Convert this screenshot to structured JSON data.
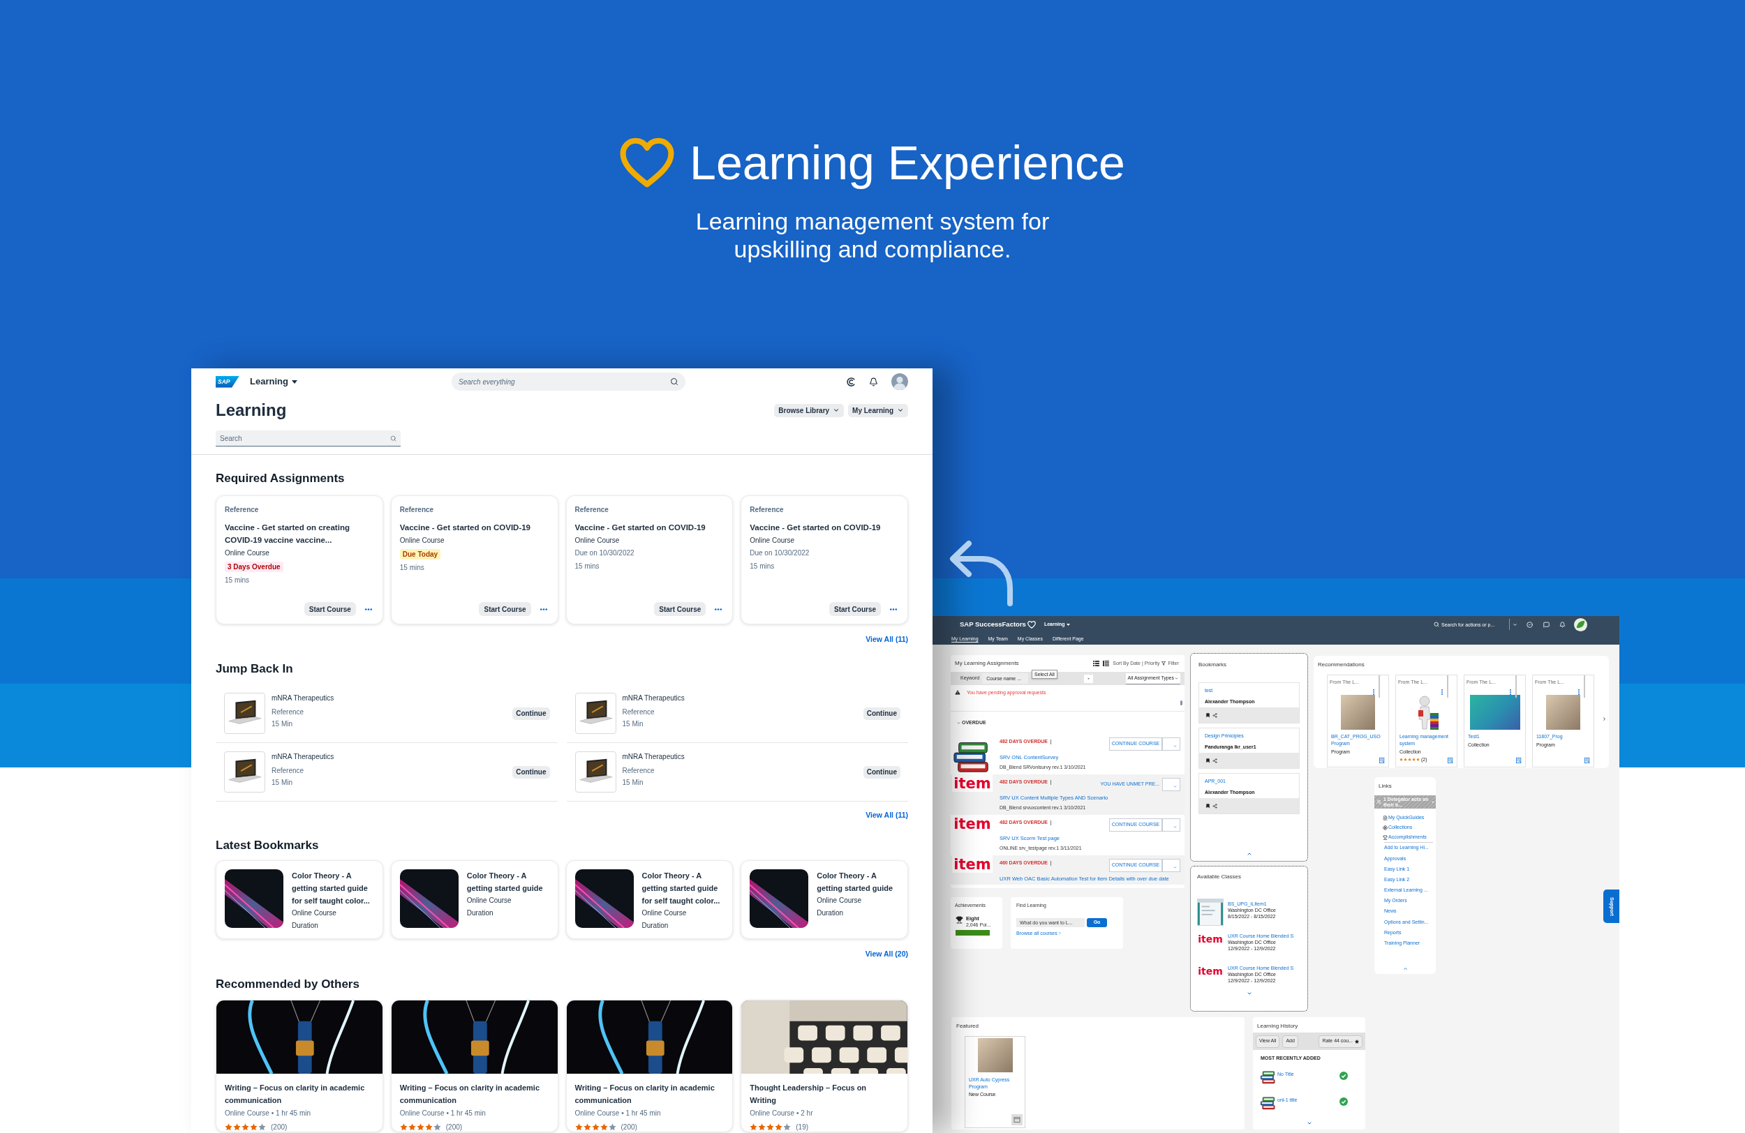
{
  "hero": {
    "title": "Learning Experience",
    "subtitle": "Learning management system for upskilling and compliance."
  },
  "learning_app": {
    "top_bar": {
      "logo": "SAP",
      "product": "Learning",
      "search_placeholder": "Search everything"
    },
    "page_title": "Learning",
    "header_buttons": [
      "Browse Library",
      "My Learning"
    ],
    "search": {
      "placeholder": "Search"
    },
    "required_assignments": {
      "title": "Required Assignments",
      "cards": [
        {
          "category": "Reference",
          "title": "Vaccine - Get started on creating COVID-19 vaccine vaccine...",
          "type": "Online Course",
          "status": {
            "kind": "overdue",
            "text": "3 Days Overdue"
          },
          "duration": "15 mins",
          "action": "Start Course"
        },
        {
          "category": "Reference",
          "title": "Vaccine - Get started on COVID-19",
          "type": "Online Course",
          "status": {
            "kind": "due_today",
            "text": "Due Today"
          },
          "duration": "15 mins",
          "action": "Start Course"
        },
        {
          "category": "Reference",
          "title": "Vaccine - Get started on COVID-19",
          "type": "Online Course",
          "status": {
            "kind": "due_date",
            "text": "Due on 10/30/2022"
          },
          "duration": "15 mins",
          "action": "Start Course"
        },
        {
          "category": "Reference",
          "title": "Vaccine - Get started on COVID-19",
          "type": "Online Course",
          "status": {
            "kind": "due_date",
            "text": "Due on 10/30/2022"
          },
          "duration": "15 mins",
          "action": "Start Course"
        }
      ],
      "view_all": "View All (11)"
    },
    "jump_back_in": {
      "title": "Jump Back In",
      "items": [
        {
          "title": "mNRA Therapeutics",
          "category": "Reference",
          "duration": "15 Min",
          "action": "Continue"
        },
        {
          "title": "mNRA Therapeutics",
          "category": "Reference",
          "duration": "15 Min",
          "action": "Continue"
        },
        {
          "title": "mNRA Therapeutics",
          "category": "Reference",
          "duration": "15 Min",
          "action": "Continue"
        },
        {
          "title": "mNRA Therapeutics",
          "category": "Reference",
          "duration": "15 Min",
          "action": "Continue"
        }
      ],
      "view_all": "View All (11)"
    },
    "latest_bookmarks": {
      "title": "Latest Bookmarks",
      "cards": [
        {
          "title": "Color Theory - A getting started guide for self taught color...",
          "type": "Online Course",
          "duration": "Duration"
        },
        {
          "title": "Color Theory - A getting started guide",
          "type": "Online Course",
          "duration": "Duration"
        },
        {
          "title": "Color Theory - A getting started guide for self taught color...",
          "type": "Online Course",
          "duration": "Duration"
        },
        {
          "title": "Color Theory - A getting started guide",
          "type": "Online Course",
          "duration": "Duration"
        }
      ],
      "view_all": "View All (20)"
    },
    "recommended": {
      "title": "Recommended by Others",
      "cards": [
        {
          "kind": "bulb",
          "title": "Writing – Focus on clarity in academic communication",
          "meta": "Online Course • 1 hr 45 min",
          "stars": 4,
          "count": "(200)"
        },
        {
          "kind": "bulb",
          "title": "Writing – Focus on clarity in academic communication",
          "meta": "Online Course • 1 hr 45 min",
          "stars": 4,
          "count": "(200)"
        },
        {
          "kind": "bulb",
          "title": "Writing – Focus on clarity in academic communication",
          "meta": "Online Course • 1 hr 45 min",
          "stars": 4,
          "count": "(200)"
        },
        {
          "kind": "typewriter",
          "title": "Thought Leadership – Focus on Writing",
          "meta": "Online Course • 2 hr",
          "stars": 4,
          "count": "(19)"
        }
      ]
    }
  },
  "successfactors_app": {
    "header": {
      "brand": "SAP SuccessFactors",
      "module": "Learning",
      "search_placeholder": "Search for actions or p...",
      "tabs": [
        {
          "label": "My Learning",
          "selected": true
        },
        {
          "label": "My Team",
          "selected": false
        },
        {
          "label": "My Classes",
          "selected": false
        },
        {
          "label": "Different Page",
          "selected": false
        }
      ]
    },
    "assignments": {
      "title": "My Learning Assignments",
      "sort": "Sort By Date | Priority",
      "filter": "Filter",
      "keyword_label": "Keyword",
      "keyword_placeholder": "Course name ...",
      "tooltip": "Select All",
      "type_filter": "All Assignment Types",
      "alert": "You have pending approval requests",
      "group": {
        "label": "OVERDUE",
        "expanded": true
      },
      "items": [
        {
          "thumb": {
            "kind": "books"
          },
          "overdue": "482 DAYS OVERDUE",
          "action": {
            "kind": "button",
            "label": "CONTINUE COURSE"
          },
          "title": "SRV ONL ContentSurvey",
          "details": "DB_Blend SRVonlsurvy rev.1 3/10/2021"
        },
        {
          "thumb": {
            "kind": "logo",
            "text": "item"
          },
          "overdue": "482 DAYS OVERDUE",
          "action": {
            "kind": "notice",
            "label": "YOU HAVE UNMET PRE..."
          },
          "title": "SRV UX Content Multiple Types AND Scenario",
          "details": "DB_Blend srvuxcontent rev.1 3/10/2021"
        },
        {
          "thumb": {
            "kind": "logo",
            "text": "item"
          },
          "overdue": "482 DAYS OVERDUE",
          "action": {
            "kind": "button",
            "label": "CONTINUE COURSE"
          },
          "title": "SRV UX Scorm Test page",
          "details": "ONLINE srv_testpage rev.1 3/11/2021"
        },
        {
          "thumb": {
            "kind": "logo",
            "text": "item"
          },
          "overdue": "460 DAYS OVERDUE",
          "action": {
            "kind": "button",
            "label": "CONTINUE COURSE"
          },
          "title": "UXR Web OAC Basic Automation Test for item Details with over due date"
        }
      ]
    },
    "achievements": {
      "title": "Achievements",
      "level_name": "Eight",
      "points": "2,046 Poi...",
      "level": 1
    },
    "find_learning": {
      "title": "Find Learning",
      "placeholder": "What do you want to L...",
      "button": "Go",
      "link": "Browse all courses"
    },
    "bookmarks": {
      "title": "Bookmarks",
      "items": [
        {
          "title": "test",
          "author": "Alexander Thompson"
        },
        {
          "title": "Design Priniciples",
          "author": "Panduranga lkr_user1"
        },
        {
          "title": "APR_001",
          "author": "Alexander Thompson"
        }
      ]
    },
    "available_classes": {
      "title": "Available Classes",
      "items": [
        {
          "thumb": {
            "kind": "screenshot"
          },
          "title": "BS_UPG_ILItem1",
          "location": "Washington DC Office",
          "dates": "8/15/2022 - 8/15/2022"
        },
        {
          "thumb": {
            "kind": "logo",
            "text": "item"
          },
          "title": "UXR Course Home Blended S",
          "location": "Washington DC Office",
          "dates": "12/9/2022 - 12/9/2022"
        },
        {
          "thumb": {
            "kind": "logo",
            "text": "item"
          },
          "title": "UXR Course Home Blended S",
          "location": "Washington DC Office",
          "dates": "12/9/2022 - 12/9/2022"
        }
      ]
    },
    "recommendations": {
      "title": "Recommendations",
      "cards": [
        {
          "source": "From The L...",
          "image": {
            "kind": "photo"
          },
          "title": "BR_CAT_PROG_USO Program",
          "type": "Program"
        },
        {
          "source": "From The L...",
          "image": {
            "kind": "figure"
          },
          "title": "Learning management system",
          "type": "Collection",
          "stars": 5,
          "count": "(2)"
        },
        {
          "source": "From The L...",
          "image": {
            "kind": "gradient"
          },
          "title": "Test1",
          "type": "Collection"
        },
        {
          "source": "From The L...",
          "image": {
            "kind": "photo"
          },
          "title": "11807_Prog",
          "type": "Program"
        }
      ]
    },
    "links": {
      "title": "Links",
      "delegator": "1 Delegator acts on their b...",
      "pinned": [
        "My QuickGuides",
        "Collections",
        "Accomplishments"
      ],
      "items": [
        "Add to Learning Hi...",
        "Approvals",
        "Easy Link 1",
        "Easy Link 2",
        "External Learning ...",
        "My Orders",
        "News",
        "Options and Settin...",
        "Reports",
        "Training Planner"
      ]
    },
    "featured": {
      "title": "Featured",
      "card": {
        "title": "UXR Auto Cypress Program",
        "type": "New Course"
      }
    },
    "learning_history": {
      "title": "Learning History",
      "buttons": [
        "View All",
        "Add",
        "Rate 44 cou..."
      ],
      "heading": "MOST RECENTLY ADDED",
      "items": [
        {
          "title": "No Title",
          "completed": true
        },
        {
          "title": "onl-1 title",
          "completed": true
        }
      ]
    },
    "support": "Support"
  }
}
